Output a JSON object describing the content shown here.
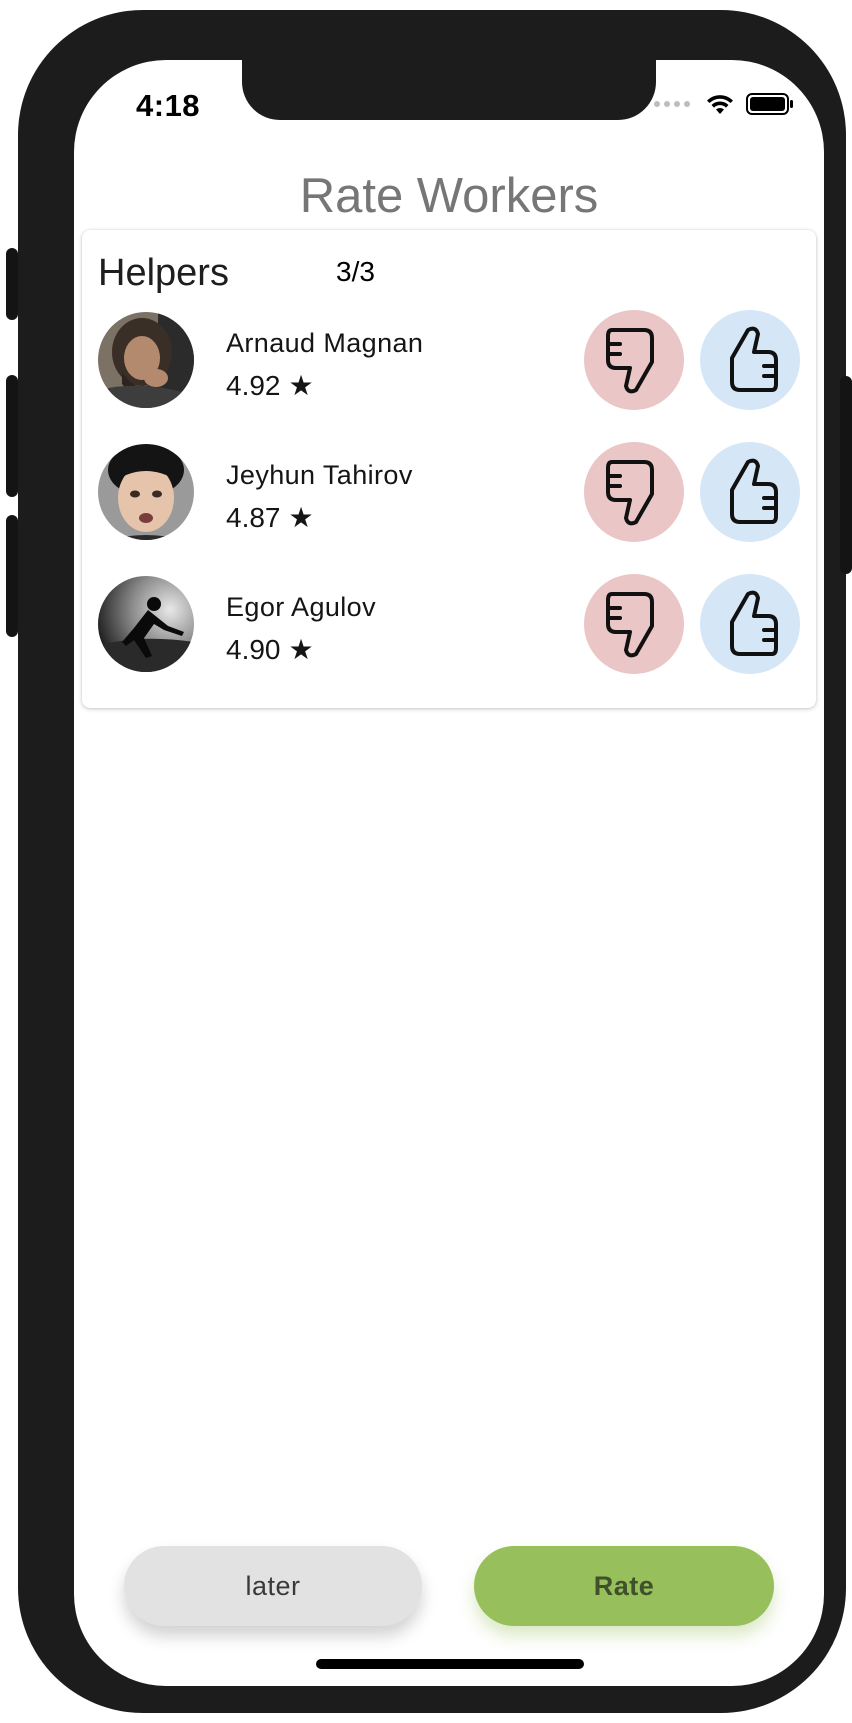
{
  "status_bar": {
    "time": "4:18",
    "icons": [
      "cellular-icon",
      "wifi-icon",
      "battery-icon"
    ]
  },
  "header": {
    "title": "Rate Workers"
  },
  "helpers": {
    "title": "Helpers",
    "count": "3/3",
    "workers": [
      {
        "name": "Arnaud Magnan",
        "rating": "4.92",
        "star": "★"
      },
      {
        "name": "Jeyhun Tahirov",
        "rating": "4.87",
        "star": "★"
      },
      {
        "name": "Egor Agulov",
        "rating": "4.90",
        "star": "★"
      }
    ],
    "icons": {
      "down": "thumbs-down-icon",
      "up": "thumbs-up-icon"
    }
  },
  "actions": {
    "later_label": "later",
    "rate_label": "Rate"
  },
  "colors": {
    "dislike_bg": "#eac6c6",
    "like_bg": "#d5e6f6",
    "rate_bg": "#97c05d",
    "later_bg": "#e2e2e2",
    "title_gray": "#767676"
  }
}
